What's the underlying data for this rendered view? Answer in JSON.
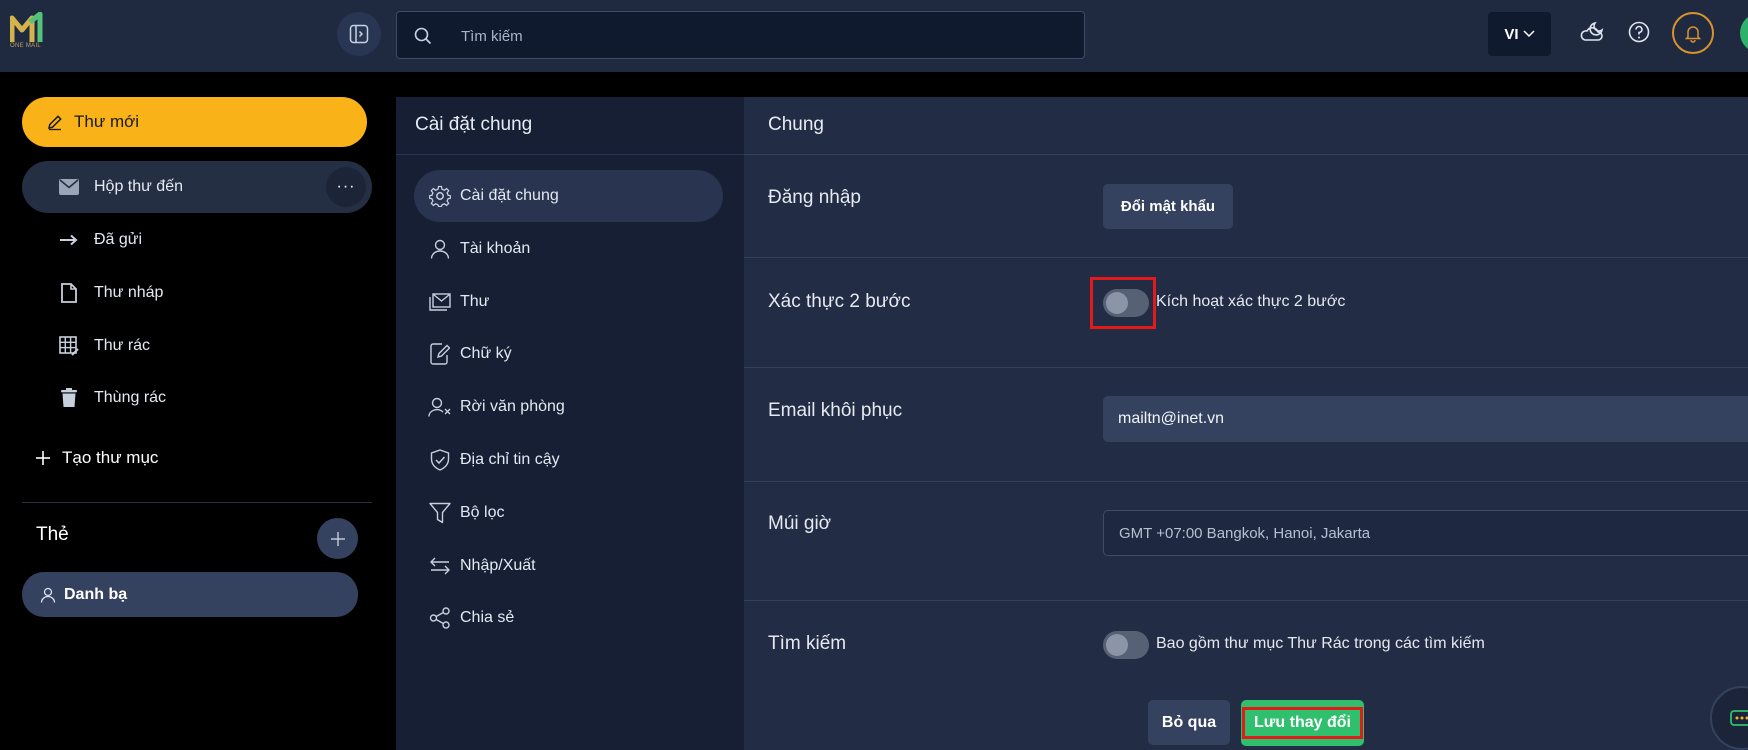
{
  "app": {
    "logo_text": "ONE MAIL",
    "brand_colors": {
      "logo_gold": "#d4b24c",
      "logo_green": "#55c27a"
    }
  },
  "header": {
    "search_placeholder": "Tìm kiếm",
    "language": "VI",
    "icons": [
      "sidebar-toggle-icon",
      "search-icon",
      "chevron-down-icon",
      "theme-icon",
      "help-icon",
      "bell-icon"
    ]
  },
  "sidebar": {
    "compose_label": "Thư mới",
    "folders": [
      {
        "label": "Hộp thư đến",
        "icon": "inbox-icon",
        "active": true
      },
      {
        "label": "Đã gửi",
        "icon": "sent-icon"
      },
      {
        "label": "Thư nháp",
        "icon": "draft-icon"
      },
      {
        "label": "Thư rác",
        "icon": "spam-icon"
      },
      {
        "label": "Thùng rác",
        "icon": "trash-icon"
      }
    ],
    "more_label": "···",
    "new_folder_label": "Tạo thư mục",
    "tags_title": "Thẻ",
    "tags": [
      {
        "label": "Danh bạ"
      }
    ]
  },
  "settings_nav": {
    "title": "Cài đặt chung",
    "items": [
      {
        "label": "Cài đặt chung",
        "icon": "gear-icon",
        "active": true
      },
      {
        "label": "Tài khoản",
        "icon": "user-icon"
      },
      {
        "label": "Thư",
        "icon": "mail-icon"
      },
      {
        "label": "Chữ ký",
        "icon": "signature-icon"
      },
      {
        "label": "Rời văn phòng",
        "icon": "user-away-icon"
      },
      {
        "label": "Địa chỉ tin cậy",
        "icon": "shield-check-icon"
      },
      {
        "label": "Bộ lọc",
        "icon": "filter-icon"
      },
      {
        "label": "Nhập/Xuất",
        "icon": "import-export-icon"
      },
      {
        "label": "Chia sẻ",
        "icon": "share-icon"
      }
    ]
  },
  "content": {
    "title": "Chung",
    "login": {
      "label": "Đăng nhập",
      "button": "Đổi mật khẩu"
    },
    "two_factor": {
      "label": "Xác thực 2 bước",
      "toggle_label": "Kích hoạt xác thực 2 bước",
      "enabled": false
    },
    "recovery_email": {
      "label": "Email khôi phục",
      "value": "mailtn@inet.vn"
    },
    "timezone": {
      "label": "Múi giờ",
      "value": "GMT +07:00 Bangkok, Hanoi, Jakarta"
    },
    "search": {
      "label": "Tìm kiếm",
      "toggle_label": "Bao gồm thư mục Thư Rác trong các tìm kiếm",
      "enabled": false
    }
  },
  "footer": {
    "skip_label": "Bỏ qua",
    "save_label": "Lưu thay đổi"
  },
  "colors": {
    "accent": "#fab219",
    "save": "#2fbf6d",
    "highlight": "#e21a1a"
  }
}
